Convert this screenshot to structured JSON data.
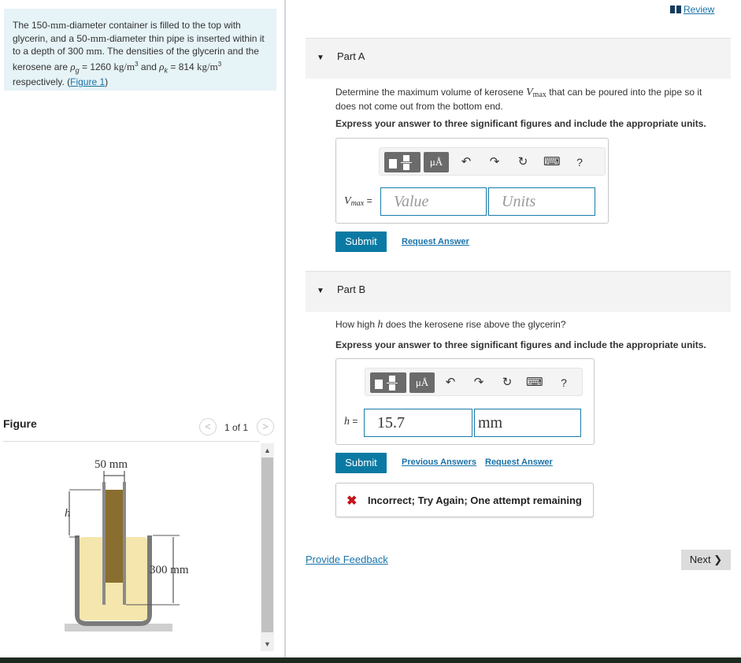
{
  "problem": {
    "text_1": "The 150-",
    "unit_mm": "mm",
    "text_2": "-diameter container is filled to the top with glycerin, and a 50-",
    "text_3": "-diameter thin pipe is inserted within it to a depth of 300 ",
    "text_4": ". The densities of the glycerin and the kerosene are ",
    "rho": "ρ",
    "sub_g": "g",
    "sub_k": "k",
    "eq_g": " = 1260 ",
    "density_unit": "kg/m",
    "cube": "3",
    "and": " and ",
    "eq_k": " = 814 ",
    "text_5": " respectively. (",
    "figure_link": "Figure 1",
    "close_paren": ")"
  },
  "figure": {
    "header": "Figure",
    "counter": "1 of 1",
    "prev": "<",
    "next": ">",
    "label_50": "50 mm",
    "label_h": "h",
    "label_300": "300 mm",
    "scroll_up": "▲",
    "scroll_down": "▼"
  },
  "review": {
    "label": "Review"
  },
  "partA": {
    "caret": "▼",
    "label": "Part A",
    "question_1": "Determine the maximum volume of kerosene ",
    "var": "V",
    "var_sub": "max",
    "question_2": " that can be poured into the pipe so it does not come out from the bottom end.",
    "instruction": "Express your answer to three significant figures and include the appropriate units.",
    "input_var": "V",
    "input_sub": "max",
    "eq": " =",
    "value_placeholder": "Value",
    "units_placeholder": "Units",
    "submit": "Submit",
    "request_answer": "Request Answer"
  },
  "partB": {
    "caret": "▼",
    "label": "Part B",
    "question_1": "How high ",
    "var": "h",
    "question_2": " does the kerosene rise above the glycerin?",
    "instruction": "Express your answer to three significant figures and include the appropriate units.",
    "input_var": "h",
    "eq": " =",
    "value": "15.7",
    "units": "mm",
    "submit": "Submit",
    "previous_answers": "Previous Answers",
    "request_answer": "Request Answer",
    "feedback_icon": "✖",
    "feedback": "Incorrect; Try Again; One attempt remaining"
  },
  "toolbar": {
    "mu": "μÅ",
    "undo": "↶",
    "redo": "↷",
    "reset": "↻",
    "keyboard": "⌨",
    "help": "?"
  },
  "footer": {
    "provide_feedback": "Provide Feedback",
    "next": "Next ❯"
  },
  "colors": {
    "accent": "#0b7aa3",
    "link": "#1a73a8",
    "problem_bg": "#e6f3f7",
    "incorrect": "#c4161c"
  }
}
